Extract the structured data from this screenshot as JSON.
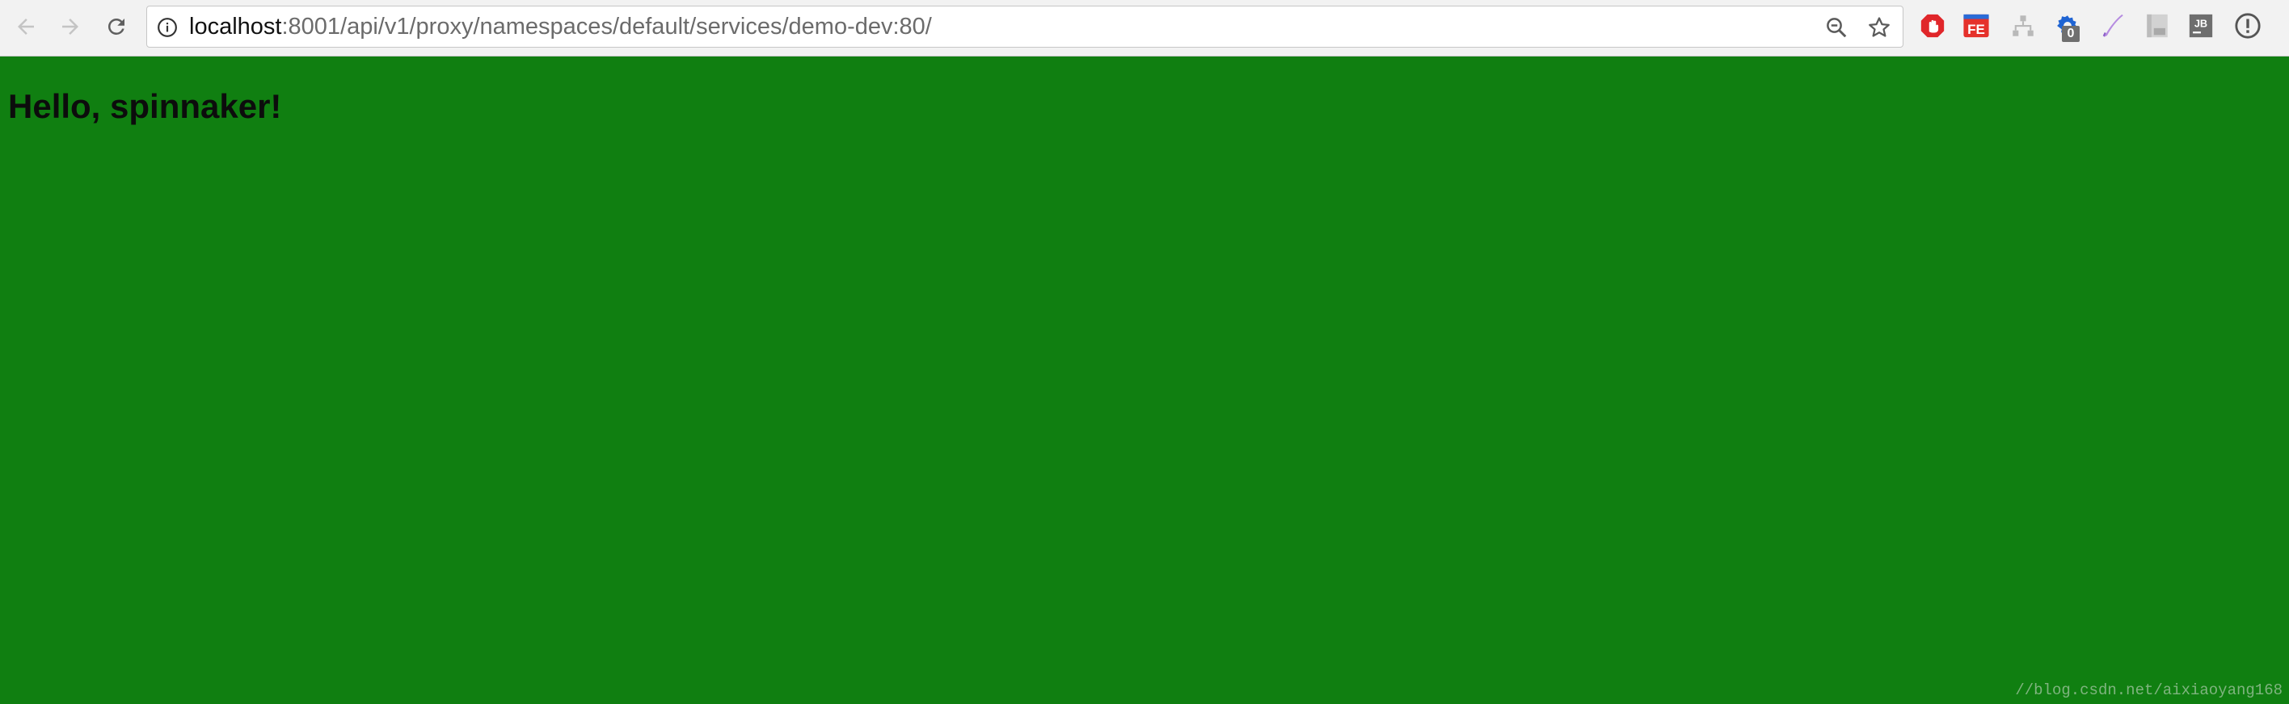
{
  "browser": {
    "url_host": "localhost",
    "url_path": ":8001/api/v1/proxy/namespaces/default/services/demo-dev:80/",
    "extension_badge": "0"
  },
  "page": {
    "heading": "Hello, spinnaker!",
    "background_color": "#107f11"
  },
  "watermark": "//blog.csdn.net/aixiaoyang168",
  "icons": [
    "back-arrow-icon",
    "forward-arrow-icon",
    "reload-icon",
    "info-icon",
    "zoom-out-icon",
    "star-icon",
    "adblock-icon",
    "fe-icon",
    "org-chart-icon",
    "gear-icon",
    "pen-icon",
    "pdf-icon",
    "jb-icon",
    "info-circle-icon"
  ]
}
